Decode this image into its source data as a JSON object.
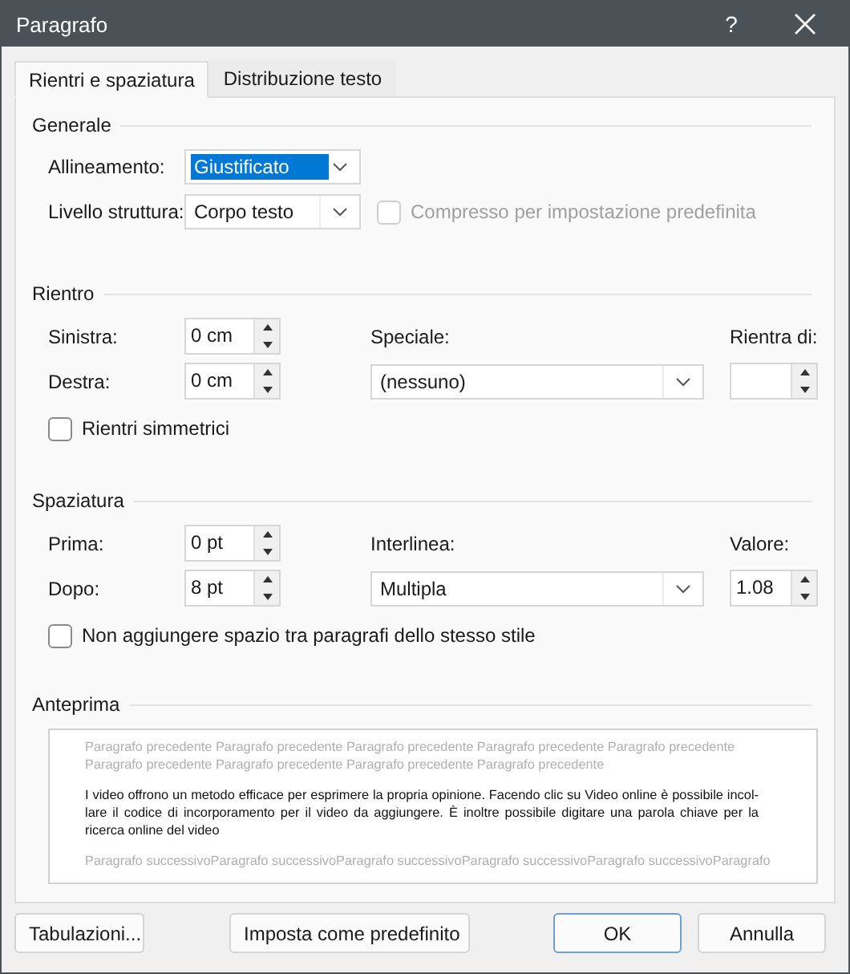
{
  "window": {
    "title": "Paragrafo",
    "help": "?"
  },
  "tabs": [
    {
      "label": "Rientri e spaziatura",
      "selected": true
    },
    {
      "label": "Distribuzione testo",
      "selected": false
    }
  ],
  "general": {
    "title": "Generale",
    "alignment": {
      "label": "Allineamento:",
      "value": "Giustificato",
      "text_selected": true
    },
    "outline": {
      "label": "Livello struttura:",
      "value": "Corpo testo"
    },
    "collapsed": {
      "label": "Compresso per impostazione predefinita",
      "checked": false,
      "disabled": true
    }
  },
  "indent": {
    "title": "Rientro",
    "left": {
      "label": "Sinistra:",
      "value": "0 cm"
    },
    "right": {
      "label": "Destra:",
      "value": "0 cm"
    },
    "special": {
      "label": "Speciale:",
      "value": "(nessuno)"
    },
    "by": {
      "label": "Rientra di:"
    },
    "mirror": {
      "label": "Rientri simmetrici",
      "checked": false,
      "disabled": false
    }
  },
  "spacing": {
    "title": "Spaziatura",
    "before": {
      "label": "Prima:",
      "value": "0 pt"
    },
    "after": {
      "label": "Dopo:",
      "value": "8 pt"
    },
    "line": {
      "label": "Interlinea:",
      "value": "Multipla"
    },
    "at": {
      "label": "Valore:",
      "value": "1.08"
    },
    "dont_add": {
      "label": "Non aggiungere spazio tra paragrafi dello stesso stile",
      "checked": false,
      "disabled": false
    }
  },
  "preview": {
    "title": "Anteprima",
    "previous": "Paragrafo precedente Paragrafo precedente Paragrafo precedente Paragrafo precedente Paragrafo precedente Paragrafo precedente Paragrafo precedente Paragrafo precedente Paragrafo precedente",
    "text": "I video offrono un metodo efficace per esprimere la propria opinione. Facendo clic su Video online è possibile incol-lare il codice di incorporamento per il video da aggiungere. È inoltre possibile digitare una parola chiave per la ricerca online del video",
    "next": "Paragrafo successivoParagrafo successivoParagrafo successivoParagrafo successivoParagrafo successivoParagrafo"
  },
  "buttons": [
    {
      "label": "Tabulazioni...",
      "default": false
    },
    {
      "label": "Imposta come predefinito",
      "default": false
    },
    {
      "label": "OK",
      "default": true
    },
    {
      "label": "Annulla",
      "default": false
    }
  ]
}
